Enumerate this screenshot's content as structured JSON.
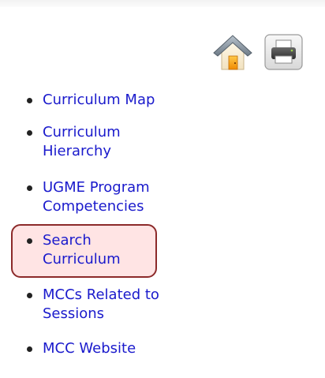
{
  "toolbar": {
    "home_icon": "home-icon",
    "print_icon": "print-icon"
  },
  "nav": {
    "link_color": "#1a1acc",
    "highlight_color": "#8c2a2a",
    "items": [
      {
        "label": "Curriculum Map"
      },
      {
        "label": "Curriculum Hierarchy"
      },
      {
        "label": "UGME Program Competencies"
      },
      {
        "label": "Search Curriculum",
        "highlighted": true
      },
      {
        "label": "MCCs Related to Sessions"
      },
      {
        "label": "MCC Website"
      }
    ]
  }
}
